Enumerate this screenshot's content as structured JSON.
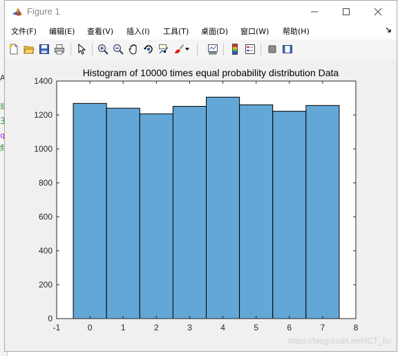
{
  "background": {
    "fragments": [
      {
        "text": "AE",
        "color": "#333333"
      },
      {
        "text": "或",
        "color": "#2e8b2e"
      },
      {
        "text": "王",
        "color": "#2e8b2e"
      },
      {
        "text": "q",
        "color": "#a020f0"
      },
      {
        "text": "频",
        "color": "#2e8b2e"
      }
    ]
  },
  "window": {
    "title": "Figure 1",
    "app_icon": "matlab-logo-icon",
    "controls": [
      "minimize-icon",
      "maximize-icon",
      "close-icon"
    ]
  },
  "menu": {
    "items": [
      "文件(F)",
      "编辑(E)",
      "查看(V)",
      "插入(I)",
      "工具(T)",
      "桌面(D)",
      "窗口(W)",
      "帮助(H)"
    ],
    "extra_icon": "dock-arrow-icon"
  },
  "toolbar": {
    "icons": [
      "new-figure-icon",
      "open-file-icon",
      "save-icon",
      "print-icon",
      "edit-plot-icon",
      "zoom-in-icon",
      "zoom-out-icon",
      "pan-icon",
      "rotate-3d-icon",
      "data-cursor-icon",
      "brush-icon",
      "brush-dropdown-icon",
      "link-plot-icon",
      "colorbar-icon",
      "legend-icon",
      "hide-plot-tools-icon",
      "show-plot-tools-icon"
    ]
  },
  "chart_data": {
    "type": "bar",
    "title": "Histogram of 10000 times equal probability distribution Data",
    "xlabel": "",
    "ylabel": "",
    "categories": [
      0,
      1,
      2,
      3,
      4,
      5,
      6,
      7
    ],
    "values": [
      1268,
      1240,
      1207,
      1251,
      1305,
      1260,
      1222,
      1256
    ],
    "xlim": [
      -1,
      8
    ],
    "ylim": [
      0,
      1400
    ],
    "xticks": [
      "-1",
      "0",
      "1",
      "2",
      "3",
      "4",
      "5",
      "6",
      "7",
      "8"
    ],
    "yticks": [
      "0",
      "200",
      "400",
      "600",
      "800",
      "1000",
      "1200",
      "1400"
    ],
    "bar_color": "#63a7d7",
    "edge_color": "#000000",
    "grid": false
  },
  "watermark": "https://blog.csdn.net/ICT_liu"
}
